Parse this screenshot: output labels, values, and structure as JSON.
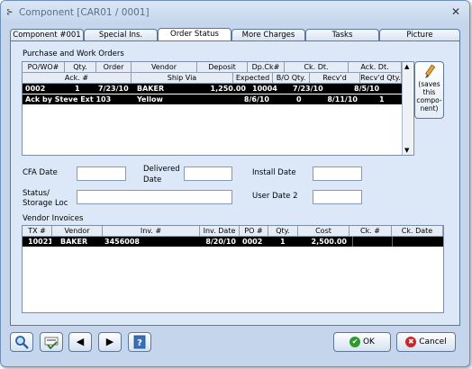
{
  "window": {
    "title": "Component [CAR01 / 0001]",
    "close": "✕"
  },
  "tabs": [
    {
      "label": "Component #001"
    },
    {
      "label": "Special Ins."
    },
    {
      "label": "Order Status"
    },
    {
      "label": "More Charges"
    },
    {
      "label": "Tasks"
    },
    {
      "label": "Picture"
    }
  ],
  "purchase": {
    "section_label": "Purchase and Work Orders",
    "header1": [
      "PO/WO#",
      "Qty.",
      "Order",
      "Vendor",
      "Deposit",
      "Dp.Ck#",
      "Ck. Dt.",
      "Ack. Dt."
    ],
    "header2": [
      "Ack. #",
      "Ship Via",
      "Expected",
      "B/O Qty.",
      "Recv'd",
      "Recv'd Qty."
    ],
    "row1": [
      "0002",
      "1",
      "7/23/10",
      "BAKER",
      "1,250.00",
      "10004",
      "7/23/10",
      "8/5/10"
    ],
    "row2": [
      "Ack by Steve Ext 103",
      "Yellow",
      "8/6/10",
      "0",
      "8/11/10",
      "1"
    ]
  },
  "saves_button": {
    "line1": "(saves",
    "line2": "this",
    "line3": "compo-",
    "line4": "nent)"
  },
  "fields": {
    "cfa_label": "CFA Date",
    "delivered_label_1": "Delivered",
    "delivered_label_2": "Date",
    "install_label": "Install Date",
    "status_label_1": "Status/",
    "status_label_2": "Storage Loc",
    "user_date2_label": "User Date 2",
    "cfa_value": "",
    "delivered_value": "",
    "install_value": "",
    "status_value": "",
    "user_date2_value": ""
  },
  "invoices": {
    "section_label": "Vendor Invoices",
    "headers": [
      "TX #",
      "Vendor",
      "Inv. #",
      "Inv. Date",
      "PO #",
      "Qty.",
      "Cost",
      "Ck. #",
      "Ck. Date"
    ],
    "row": [
      "10021",
      "BAKER",
      "3456008",
      "8/20/10",
      "0002",
      "1",
      "2,500.00",
      "",
      ""
    ]
  },
  "buttons": {
    "ok": "OK",
    "cancel": "Cancel"
  },
  "colors": {
    "accent": "#5d7799",
    "window_bg": "#c5d6ec",
    "panel_bg": "#dce8f7",
    "selected_row": "#000000"
  }
}
